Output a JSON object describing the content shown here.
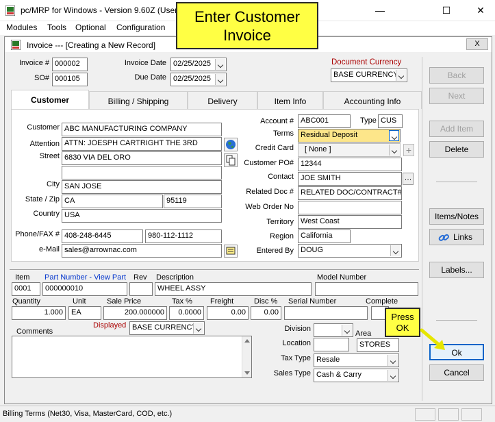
{
  "app": {
    "title": "pc/MRP for Windows - Version 9.60Z  (User"
  },
  "menu": [
    "Modules",
    "Tools",
    "Optional",
    "Configuration"
  ],
  "callouts": {
    "top": "Enter Customer\nInvoice",
    "ok": "Press\nOK"
  },
  "window": {
    "title": "Invoice --- [Creating a New Record]",
    "close_label": "X"
  },
  "header": {
    "invoice_label": "Invoice #",
    "invoice": "000002",
    "so_label": "SO#",
    "so": "000105",
    "invoice_date_label": "Invoice Date",
    "invoice_date": "02/25/2025",
    "due_date_label": "Due Date",
    "due_date": "02/25/2025",
    "currency_label": "Document Currency",
    "currency": "BASE CURRENCY"
  },
  "tabs": [
    "Customer",
    "Billing / Shipping",
    "Delivery",
    "Item Info",
    "Accounting Info"
  ],
  "customer": {
    "customer_label": "Customer",
    "customer": "ABC MANUFACTURING COMPANY",
    "attention_label": "Attention",
    "attention": "ATTN: JOESPH CARTRIGHT THE 3RD",
    "street_label": "Street",
    "street1": "6830 VIA DEL ORO",
    "street2": "",
    "city_label": "City",
    "city": "SAN JOSE",
    "statezip_label": "State / Zip",
    "state": "CA",
    "zip": "95119",
    "country_label": "Country",
    "country": "USA",
    "phonefax_label": "Phone/FAX #",
    "phone": "408-248-6445",
    "fax": "980-112-1112",
    "email_label": "e-Mail",
    "email": "sales@arrownac.com"
  },
  "account": {
    "account_label": "Account #",
    "account": "ABC001",
    "type_label": "Type",
    "type": "CUS",
    "terms_label": "Terms",
    "terms": "Residual Deposit",
    "credit_card_label": "Credit Card",
    "credit_card": "[ None ]",
    "customer_po_label": "Customer PO#",
    "customer_po": "12344",
    "contact_label": "Contact",
    "contact": "JOE SMITH",
    "related_doc_label": "Related Doc #",
    "related_doc": "RELATED DOC/CONTRACT#",
    "web_order_label": "Web Order No",
    "web_order": "",
    "territory_label": "Territory",
    "territory": "West Coast",
    "region_label": "Region",
    "region": "California",
    "entered_by_label": "Entered By",
    "entered_by": "DOUG"
  },
  "item": {
    "item_label": "Item",
    "item": "0001",
    "part_label": "Part Number - View Part",
    "part": "000000010",
    "rev_label": "Rev",
    "rev": "",
    "desc_label": "Description",
    "desc": "WHEEL ASSY",
    "model_label": "Model Number",
    "model": "",
    "qty_label": "Quantity",
    "qty": "1.000",
    "unit_label": "Unit",
    "unit": "EA",
    "price_label": "Sale Price",
    "price": "200.000000",
    "tax_label": "Tax %",
    "tax": "0.0000",
    "freight_label": "Freight",
    "freight": "0.00",
    "disc_label": "Disc %",
    "disc": "0.00",
    "serial_label": "Serial Number",
    "serial": "",
    "complete_label": "Complete",
    "displayed_label": "Displayed",
    "displayed": "BASE CURRENCY",
    "comments_label": "Comments",
    "comments": "",
    "division_label": "Division",
    "division": "",
    "area_label": "Area",
    "location_label": "Location",
    "location": "",
    "area": "STORES",
    "tax_type_label": "Tax Type",
    "tax_type": "Resale",
    "sales_type_label": "Sales Type",
    "sales_type": "Cash & Carry"
  },
  "side_buttons": {
    "back": "Back",
    "next": "Next",
    "add_item": "Add Item",
    "delete": "Delete",
    "items_notes": "Items/Notes",
    "links": "Links",
    "labels": "Labels...",
    "ok": "Ok",
    "cancel": "Cancel"
  },
  "status": "Billing Terms (Net30, Visa, MasterCard, COD, etc.)",
  "colors": {
    "callout": "#ffff44",
    "terms_highlight": "#fde68a",
    "link_blue": "#0033cc",
    "red_label": "#aa0000"
  }
}
